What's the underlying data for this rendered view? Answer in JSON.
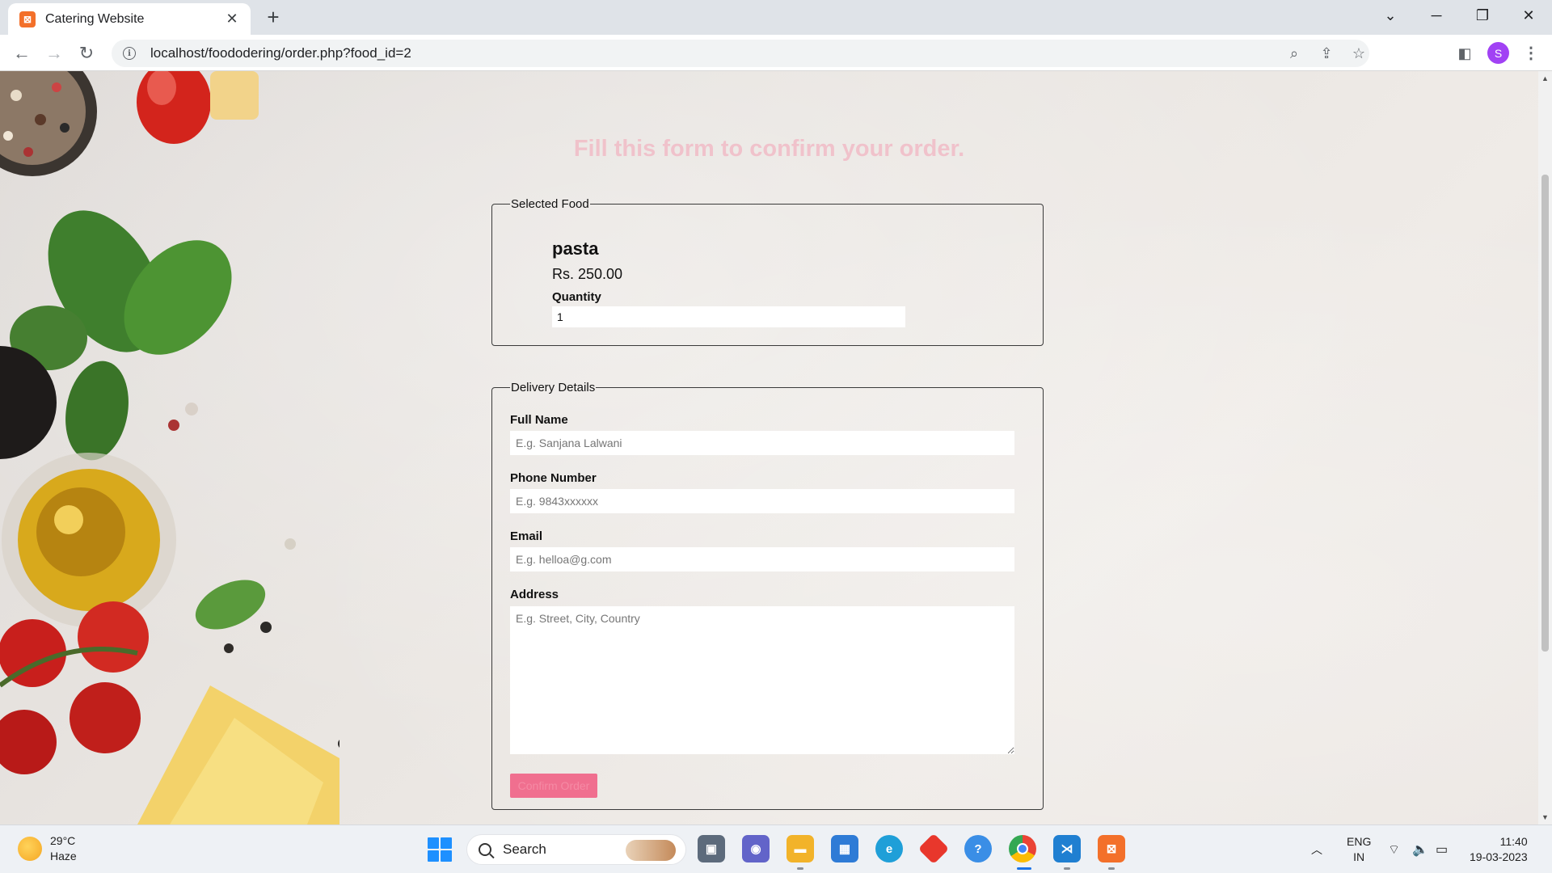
{
  "browser": {
    "tab_title": "Catering Website",
    "tab_favicon": "xampp-icon",
    "url": "localhost/foododering/order.php?food_id=2",
    "profile_initial": "S"
  },
  "page": {
    "heading": "Fill this form to confirm your order.",
    "selected_food": {
      "legend": "Selected Food",
      "name": "pasta",
      "price": "Rs. 250.00",
      "quantity_label": "Quantity",
      "quantity_value": "1"
    },
    "delivery": {
      "legend": "Delivery Details",
      "full_name_label": "Full Name",
      "full_name_placeholder": "E.g. Sanjana Lalwani",
      "phone_label": "Phone Number",
      "phone_placeholder": "E.g. 9843xxxxxx",
      "email_label": "Email",
      "email_placeholder": "E.g. helloa@g.com",
      "address_label": "Address",
      "address_placeholder": "E.g. Street, City, Country",
      "confirm_label": "Confirm Order"
    }
  },
  "taskbar": {
    "weather_temp": "29°C",
    "weather_desc": "Haze",
    "search_label": "Search",
    "lang_top": "ENG",
    "lang_bottom": "IN",
    "time": "11:40",
    "date": "19-03-2023"
  },
  "colors": {
    "heading": "#f4a3b5",
    "confirm_button": "#f06f8f",
    "profile_avatar": "#a142f4",
    "tab_favicon": "#f3702a"
  }
}
